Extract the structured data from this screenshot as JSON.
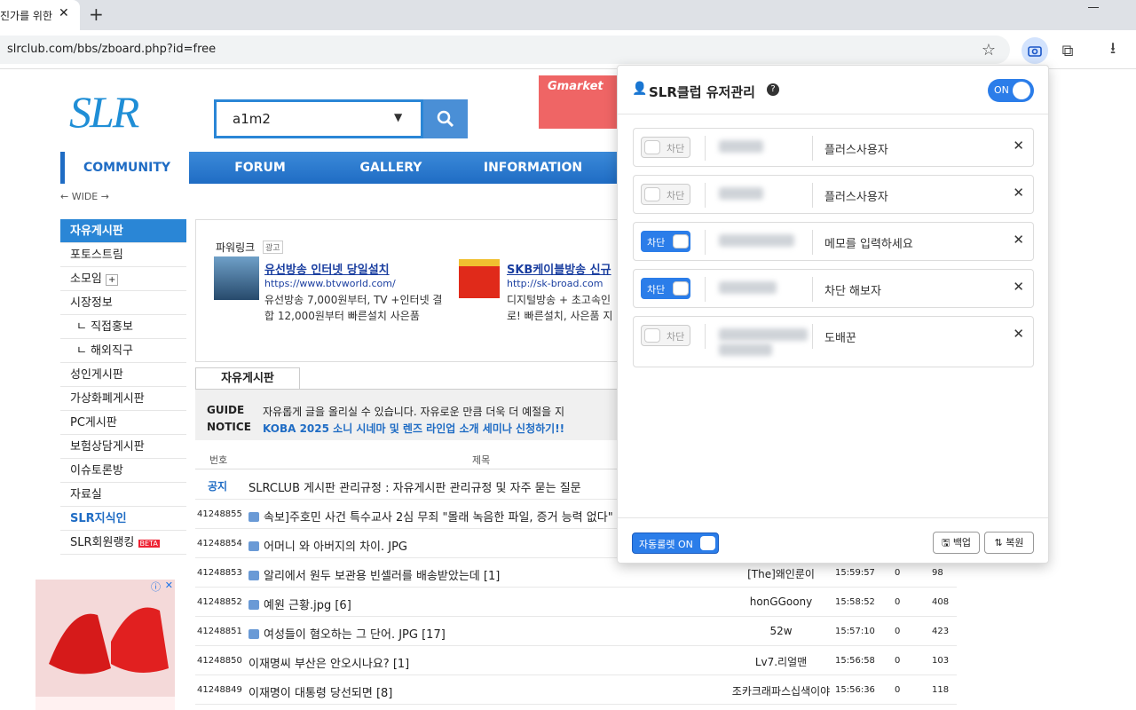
{
  "browser": {
    "tab_title": "진가를 위한",
    "url": "slrclub.com/bbs/zboard.php?id=free"
  },
  "site": {
    "logo": "SLR",
    "search_value": "a1m2",
    "ad_brand": "Gmarket",
    "nav": [
      "COMMUNITY",
      "FORUM",
      "GALLERY",
      "INFORMATION"
    ],
    "wide": "← WIDE →",
    "sidebar": [
      "자유게시판",
      "포토스트림",
      "소모임",
      "시장정보",
      "ㄴ 직접홍보",
      "ㄴ 해외직구",
      "성인게시판",
      "가상화폐게시판",
      "PC게시판",
      "보험상담게시판",
      "이슈토론방",
      "자료실",
      "SLR지식인",
      "SLR회원랭킹"
    ],
    "beta": "BETA",
    "powerlink": "파워링크",
    "ad_label": "광고",
    "ads": [
      {
        "title": "유선방송 인터넷 당일설치",
        "url": "https://www.btvworld.com/",
        "desc": "유선방송 7,000원부터, TV +인터넷 결합 12,000원부터 빠른설치 사은품"
      },
      {
        "title": "SKB케이블방송 신규",
        "url": "http://sk-broad.com",
        "desc": "디지털방송 + 초고속인로! 빠른설치, 사은품 지"
      }
    ],
    "board_tab": "자유게시판",
    "guide_label": "GUIDE",
    "guide_text": "자유롭게 글을 올리실 수 있습니다. 자유로운 만큼 더욱 더 예절을 지",
    "notice_label": "NOTICE",
    "notice_text": "KOBA 2025 소니 시네마 및 렌즈 라인업 소개 세미나 신청하기!!",
    "cols": {
      "no": "번호",
      "title": "제목"
    },
    "notice_row": {
      "no": "공지",
      "title": "SLRCLUB 게시판 관리규정 : 자유게시판 관리규정 및 자주 묻는 질문"
    },
    "rows": [
      {
        "no": "41248855",
        "title": "속보]주호민 사건 특수교사 2심 무죄 \"몰래 녹음한 파일, 증거 능력 없다\"",
        "author": "",
        "time": "",
        "rec": "",
        "views": "",
        "pic": true
      },
      {
        "no": "41248854",
        "title": "어머니 와 아버지의 차이. JPG",
        "author": "",
        "time": "",
        "rec": "",
        "views": "",
        "pic": true
      },
      {
        "no": "41248853",
        "title": "알리에서 원두 보관용 빈셀러를 배송받았는데 [1]",
        "author": "[The]왜인룬이",
        "time": "15:59:57",
        "rec": "0",
        "views": "98",
        "pic": true
      },
      {
        "no": "41248852",
        "title": "예원 근황.jpg [6]",
        "author": "honGGoony",
        "time": "15:58:52",
        "rec": "0",
        "views": "408",
        "pic": true
      },
      {
        "no": "41248851",
        "title": "여성들이 혐오하는 그 단어. JPG [17]",
        "author": "52w",
        "time": "15:57:10",
        "rec": "0",
        "views": "423",
        "pic": true
      },
      {
        "no": "41248850",
        "title": "이재명씨 부산은 안오시나요? [1]",
        "author": "Lv7.리얼맨",
        "time": "15:56:58",
        "rec": "0",
        "views": "103",
        "pic": false
      },
      {
        "no": "41248849",
        "title": "이재명이 대통령 당선되면 [8]",
        "author": "조카크래파스십색이야",
        "time": "15:56:36",
        "rec": "0",
        "views": "118",
        "pic": false
      }
    ]
  },
  "panel": {
    "title": "SLR클럽 유저관리",
    "master": "ON",
    "block_label": "차단",
    "users": [
      {
        "on": false,
        "memo": "플러스사용자"
      },
      {
        "on": false,
        "memo": "플러스사용자"
      },
      {
        "on": true,
        "memo": "메모를 입력하세요"
      },
      {
        "on": true,
        "memo": "차단 해보자"
      },
      {
        "on": false,
        "memo": "도배꾼"
      }
    ],
    "auto_label": "자동룰렛 ON",
    "backup": "백업",
    "restore": "복원"
  }
}
